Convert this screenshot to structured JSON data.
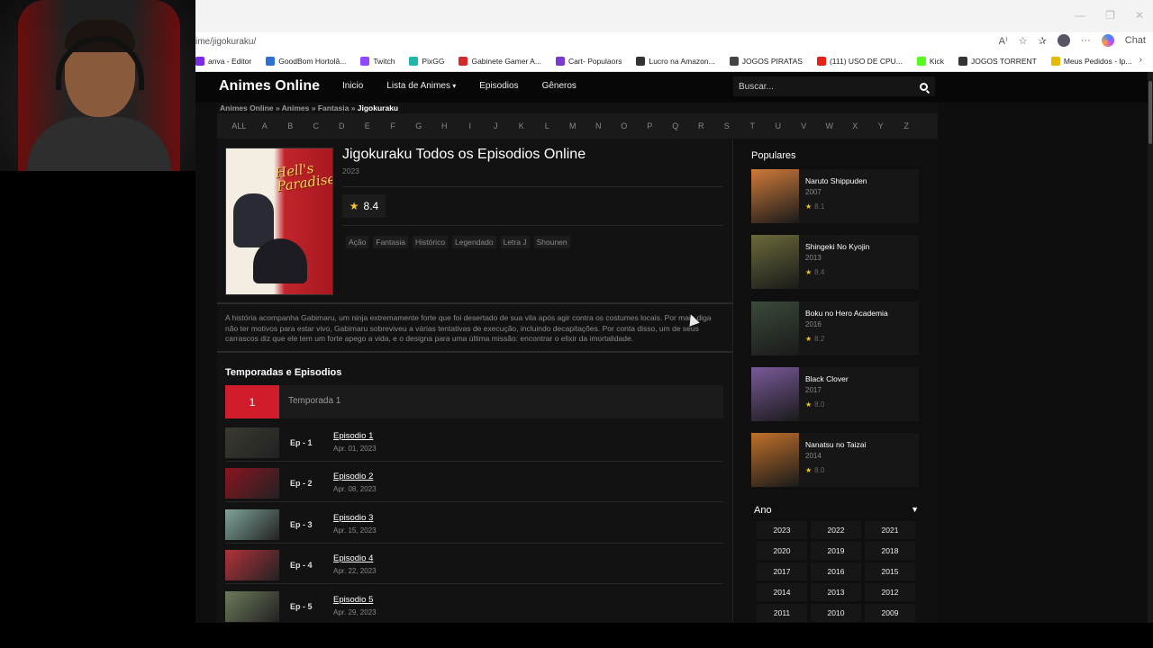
{
  "browser": {
    "url": "ime/jigokuraku/",
    "bookmarks": [
      {
        "label": "anva - Editor",
        "color": "#7d2ae8"
      },
      {
        "label": "GoodBom Hortolâ...",
        "color": "#2e6fd1"
      },
      {
        "label": "Twitch",
        "color": "#9146ff"
      },
      {
        "label": "PixGG",
        "color": "#1fb5a8"
      },
      {
        "label": "Gabinete Gamer A...",
        "color": "#d42a2a"
      },
      {
        "label": "Cart- Populaors",
        "color": "#7a3ad1"
      },
      {
        "label": "Lucro na Amazon...",
        "color": "#333333"
      },
      {
        "label": "JOGOS PIRATAS",
        "color": "#444444"
      },
      {
        "label": "(111) USO DE CPU...",
        "color": "#e62117"
      },
      {
        "label": "Kick",
        "color": "#53fc18"
      },
      {
        "label": "JOGOS TORRENT",
        "color": "#333333"
      },
      {
        "label": "Meus Pedidos - Ip...",
        "color": "#e6b800"
      }
    ],
    "chat_label": "Chat"
  },
  "site": {
    "logo": "Animes Online",
    "nav": [
      "Inicio",
      "Lista de Animes",
      "Episodios",
      "Gêneros"
    ],
    "search_placeholder": "Buscar..."
  },
  "breadcrumb": [
    "Animes Online",
    "Animes",
    "Fantasia",
    "Jigokuraku"
  ],
  "alphabet": [
    "ALL",
    "A",
    "B",
    "C",
    "D",
    "E",
    "F",
    "G",
    "H",
    "I",
    "J",
    "K",
    "L",
    "M",
    "N",
    "O",
    "P",
    "Q",
    "R",
    "S",
    "T",
    "U",
    "V",
    "W",
    "X",
    "Y",
    "Z"
  ],
  "anime": {
    "title": "Jigokuraku Todos os Episodios Online",
    "year": "2023",
    "rating": "8.4",
    "poster_text": "Hell's Paradise",
    "genres": [
      "Ação",
      "Fantasia",
      "Histórico",
      "Legendado",
      "Letra J",
      "Shounen"
    ],
    "synopsis": "A história acompanha Gabimaru, um ninja extremamente forte que foi desertado de sua vila após agir contra os costumes locais. Por mais diga não ter motivos para estar vivo, Gabimaru sobreviveu a várias tentativas de execução, incluindo decapitações. Por conta disso, um de seus carrascos diz que ele tem um forte apego a vida, e o designa para uma última missão: encontrar o elixir da imortalidade."
  },
  "seasons": {
    "title": "Temporadas e Episodios",
    "season_number": "1",
    "season_label": "Temporada 1",
    "episodes": [
      {
        "num": "Ep - 1",
        "title": "Episodio 1",
        "date": "Apr. 01, 2023",
        "color": "#3a3a30"
      },
      {
        "num": "Ep - 2",
        "title": "Episodio 2",
        "date": "Apr. 08, 2023",
        "color": "#8a1420"
      },
      {
        "num": "Ep - 3",
        "title": "Episodio 3",
        "date": "Apr. 15, 2023",
        "color": "#7fa39a"
      },
      {
        "num": "Ep - 4",
        "title": "Episodio 4",
        "date": "Apr. 22, 2023",
        "color": "#b0323a"
      },
      {
        "num": "Ep - 5",
        "title": "Episodio 5",
        "date": "Apr. 29, 2023",
        "color": "#6c7a5a"
      }
    ]
  },
  "sidebar": {
    "popular_title": "Populares",
    "popular": [
      {
        "title": "Naruto Shippuden",
        "year": "2007",
        "rating": "8.1",
        "color": "#d07a3a"
      },
      {
        "title": "Shingeki No Kyojin",
        "year": "2013",
        "rating": "8.4",
        "color": "#6a6a3a"
      },
      {
        "title": "Boku no Hero Academia",
        "year": "2016",
        "rating": "8.2",
        "color": "#3a4a3a"
      },
      {
        "title": "Black Clover",
        "year": "2017",
        "rating": "8.0",
        "color": "#7a5a9a"
      },
      {
        "title": "Nanatsu no Taizai",
        "year": "2014",
        "rating": "8.0",
        "color": "#c0702a"
      }
    ],
    "year_title": "Ano",
    "years": [
      "2023",
      "2022",
      "2021",
      "2020",
      "2019",
      "2018",
      "2017",
      "2016",
      "2015",
      "2014",
      "2013",
      "2012",
      "2011",
      "2010",
      "2009"
    ]
  }
}
